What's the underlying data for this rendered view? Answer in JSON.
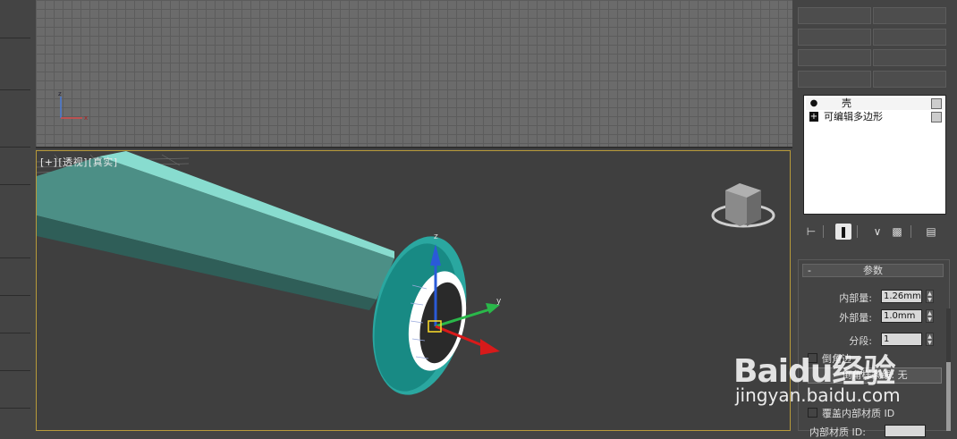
{
  "viewport_persp": {
    "label_parts": [
      "[+]",
      "[透视]",
      "[真实]"
    ],
    "border_color": "#b89a3a",
    "object_color": "#6fc7bd"
  },
  "viewport_top": {
    "axis_labels": {
      "z": "z",
      "x": "x"
    }
  },
  "command_panel": {
    "stack": [
      {
        "icon": "light-bulb-icon",
        "label": "壳"
      },
      {
        "icon": "expand-plus-icon",
        "label": "可编辑多边形"
      }
    ],
    "tools": [
      "pin-stack-icon",
      "show-end-result-icon",
      "make-unique-icon",
      "remove-modifier-icon",
      "configure-modifier-sets-icon"
    ],
    "params": {
      "title": "参数",
      "collapse_symbol": "-",
      "inner_amount": {
        "label": "内部量:",
        "value": "1.26mm"
      },
      "outer_amount": {
        "label": "外部量:",
        "value": "1.0mm"
      },
      "segments": {
        "label": "分段:",
        "value": "1"
      },
      "bevel_edges": {
        "label": "倒角边",
        "button": "倒角样条线:  无"
      },
      "override_inner_mat": {
        "label": "覆盖内部材质 ID"
      },
      "inner_mat_id": {
        "label": "内部材质 ID:"
      }
    }
  },
  "watermark": {
    "logo": "Baidu经验",
    "url": "jingyan.baidu.com"
  }
}
